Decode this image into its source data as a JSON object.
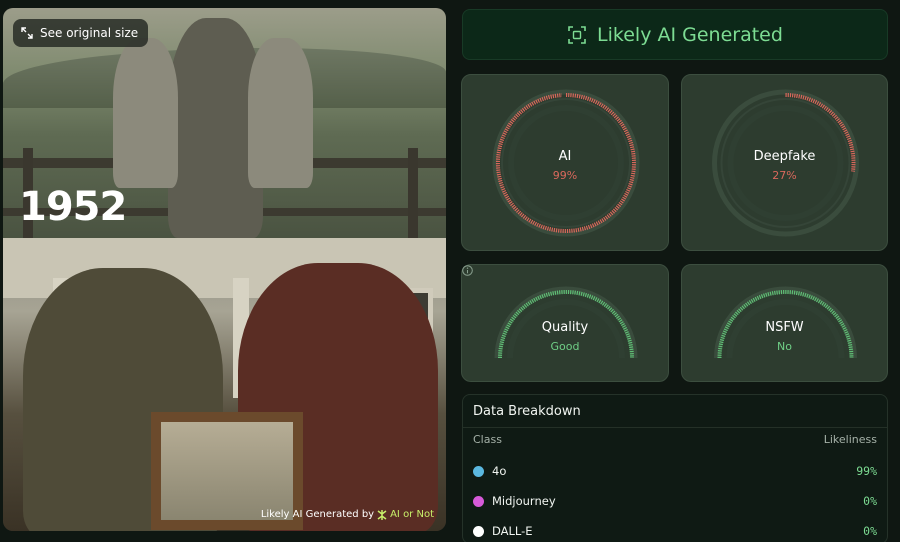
{
  "image": {
    "original_size_label": "See original size",
    "year_label": "1952",
    "watermark_prefix": "Likely AI Generated by",
    "watermark_brand": "AI or Not"
  },
  "verdict": {
    "label": "Likely AI Generated",
    "color": "#7ddc93"
  },
  "gauges": [
    {
      "label": "AI",
      "value": "99%",
      "fraction": 0.99,
      "color": "#d9685c",
      "style": "full-circle"
    },
    {
      "label": "Deepfake",
      "value": "27%",
      "fraction": 0.27,
      "color": "#d9685c",
      "style": "full-circle"
    },
    {
      "label": "Quality",
      "value": "Good",
      "fraction": 1.0,
      "color": "#5fbf75",
      "style": "half-arc",
      "info_icon": true
    },
    {
      "label": "NSFW",
      "value": "No",
      "fraction": 1.0,
      "color": "#5fbf75",
      "style": "half-arc"
    }
  ],
  "breakdown": {
    "title": "Data Breakdown",
    "col_class": "Class",
    "col_likeliness": "Likeliness",
    "rows": [
      {
        "name": "4o",
        "value": "99%",
        "dot_color": "#5bb8e0"
      },
      {
        "name": "Midjourney",
        "value": "0%",
        "dot_color": "#d65ad9"
      },
      {
        "name": "DALL-E",
        "value": "0%",
        "dot_color": "#ffffff"
      }
    ]
  }
}
